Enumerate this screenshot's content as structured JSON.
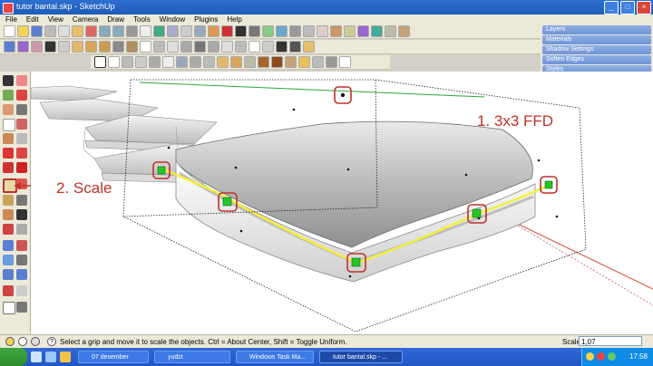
{
  "window": {
    "title": "tutor bantal.skp - SketchUp",
    "controls": [
      "_",
      "□",
      "×"
    ]
  },
  "menu": [
    "File",
    "Edit",
    "View",
    "Camera",
    "Draw",
    "Tools",
    "Window",
    "Plugins",
    "Help"
  ],
  "trays": [
    "Layers",
    "Materials",
    "Shadow Settings",
    "Soften Edges",
    "Styles"
  ],
  "annotations": {
    "ffd_label": "1. 3x3 FFD",
    "scale_label": "2. Scale"
  },
  "status": {
    "hint": "Select a grip and move it to scale the objects. Ctrl = About Center, Shift = Toggle Uniform.",
    "value_label": "Scale",
    "value": "1,07"
  },
  "taskbar": {
    "tasks": [
      "07 desember",
      "yudzt",
      "Windows Task Ma...",
      "tutor bantal.skp - ..."
    ],
    "clock": "17:58"
  },
  "colors": {
    "annotation": "#c0302a",
    "highlight_edge": "#f2ef3a",
    "grip": "#27c427",
    "selection_box": "#222222"
  }
}
